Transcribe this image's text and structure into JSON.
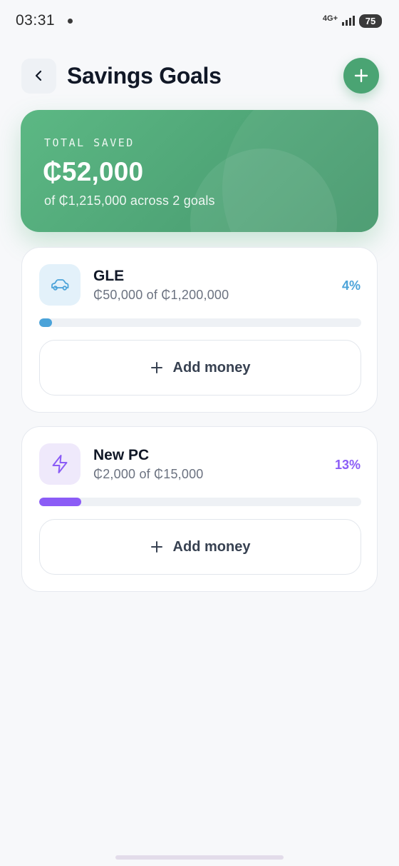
{
  "status_bar": {
    "time": "03:31",
    "network": "4G+",
    "battery": "75"
  },
  "header": {
    "title": "Savings Goals",
    "back_icon": "chevron-left-icon",
    "add_icon": "plus-icon"
  },
  "summary": {
    "label": "TOTAL SAVED",
    "amount": "₵52,000",
    "subtitle": "of ₵1,215,000 across 2 goals",
    "color": "#4fa577"
  },
  "goals": [
    {
      "name": "GLE",
      "progress_text": "₵50,000 of ₵1,200,000",
      "percent": "4%",
      "progress_fraction": 0.04,
      "icon": "car-icon",
      "accent": "#4ba3d9",
      "icon_bg": "#e3f1fa",
      "add_label": "Add money"
    },
    {
      "name": "New PC",
      "progress_text": "₵2,000 of ₵15,000",
      "percent": "13%",
      "progress_fraction": 0.13,
      "icon": "lightning-icon",
      "accent": "#8b5cf6",
      "icon_bg": "#efe9fb",
      "add_label": "Add money"
    }
  ]
}
